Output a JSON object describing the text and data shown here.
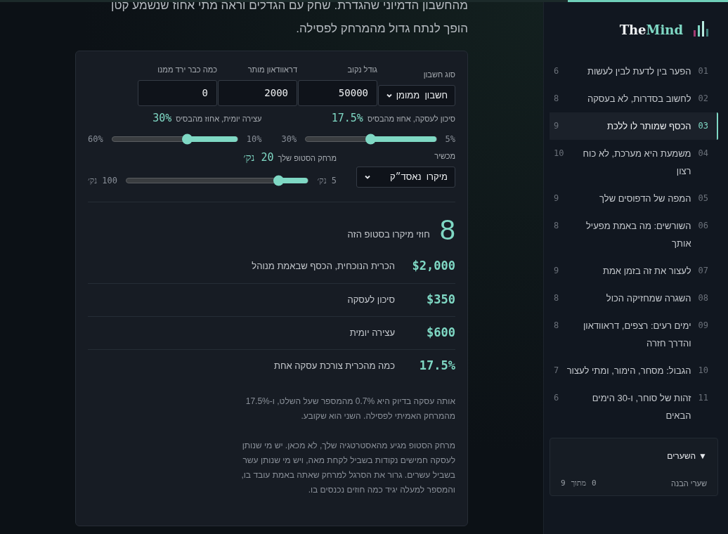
{
  "reading_progress": {
    "level": 0.22
  },
  "intro": [
    "מהחשבון הדמיוני שהגדרת. שחק עם הגדלים וראה מתי אחוז שנשמע קטן",
    "הופך לנתח גדול מהמרחק לפסילה."
  ],
  "calculator": {
    "fields": [
      {
        "kind": "select",
        "label": "סוג חשבון",
        "value": "חשבון  ממומן"
      },
      {
        "kind": "input",
        "label": "גודל נקוב",
        "value": "50000"
      },
      {
        "kind": "input",
        "label": "דראוודאון מותר",
        "value": "2000"
      },
      {
        "kind": "input",
        "label": "כמה כבר ירד ממנו",
        "value": "0"
      }
    ],
    "sliders": [
      {
        "label": "סיכון לעסקה, אחוז מהבסיס",
        "reading": "17.5%",
        "min": "5%",
        "max": "30%",
        "level": 0.5
      },
      {
        "label": "עצירה יומית, אחוז מהבסיס",
        "reading": "30%",
        "min": "10%",
        "max": "60%",
        "level": 0.4
      }
    ],
    "instrument": {
      "label": "מכשיר",
      "value": "מיקרו  נאסד״ק"
    },
    "stop_slider": {
      "label": "מרחק הסטופ שלך",
      "reading": "20 נק׳",
      "min": "5 נק׳",
      "max": "100 נק׳",
      "level": 0.16
    },
    "headline": {
      "value": "8",
      "label": "חוזי מיקרו בסטופ הזה"
    },
    "results": [
      {
        "value": "$2,000",
        "label": "הכרית הנוכחית, הכסף שבאמת מנוהל"
      },
      {
        "value": "$350",
        "label": "סיכון לעסקה"
      },
      {
        "value": "$600",
        "label": "עצירה יומית"
      },
      {
        "value": "17.5%",
        "label": "כמה מהכרית צורכת עסקה אחת"
      }
    ],
    "notes": [
      "אותה עסקה בדיוק היא 0.7% מהמספר שעל השלט, ו-17.5% מהמרחק האמיתי לפסילה. השני הוא שקובע.",
      "מרחק הסטופ מגיע מהאסטרטגיה שלך, לא מכאן. יש מי שנותן לעסקה חמישים נקודות בשביל לקחת מאה, ויש מי שנותן עשר בשביל עשרים. גרור את הסרגל למרחק שאתה באמת עובד בו, והמספר למעלה יגיד כמה חוזים נכנסים בו."
    ]
  },
  "sidebar": {
    "logo": {
      "first": "The",
      "second": "Mind"
    },
    "chapters": [
      {
        "number": "01",
        "title": "הפער בין לדעת לבין לעשות",
        "count": "6",
        "selected": false
      },
      {
        "number": "02",
        "title": "לחשוב בסדרות, לא בעסקה",
        "count": "8",
        "selected": false
      },
      {
        "number": "03",
        "title": "הכסף שמותר לו ללכת",
        "count": "9",
        "selected": true
      },
      {
        "number": "04",
        "title": "משמעת היא מערכת, לא כוח רצון",
        "count": "10",
        "selected": false
      },
      {
        "number": "05",
        "title": "המפה של הדפוסים שלך",
        "count": "9",
        "selected": false
      },
      {
        "number": "06",
        "title": "השורשים: מה באמת מפעיל אותך",
        "count": "8",
        "selected": false
      },
      {
        "number": "07",
        "title": "לעצור את זה בזמן אמת",
        "count": "9",
        "selected": false
      },
      {
        "number": "08",
        "title": "השגרה שמחזיקה הכול",
        "count": "8",
        "selected": false
      },
      {
        "number": "09",
        "title": "ימים רעים: רצפים, דראוודאון והדרך חזרה",
        "count": "8",
        "selected": false
      },
      {
        "number": "10",
        "title": "הגבול: מסחר, הימור, ומתי לעצור",
        "count": "7",
        "selected": false
      },
      {
        "number": "11",
        "title": "זהות של סוחר, ו-30 הימים הבאים",
        "count": "6",
        "selected": false
      }
    ],
    "gates": {
      "marker": "▼",
      "title": "השערים",
      "expanded": true,
      "rows": [
        {
          "label": "שערי הבנה",
          "done": "0",
          "of": "מתוך",
          "total": "9"
        }
      ]
    }
  }
}
